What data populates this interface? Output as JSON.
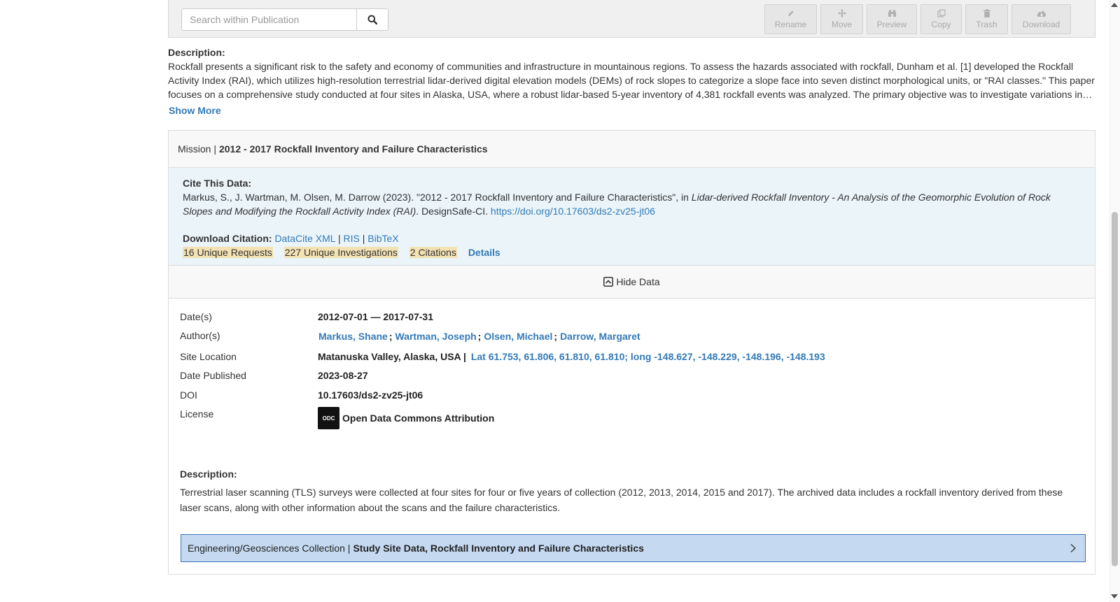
{
  "toolbar": {
    "search_placeholder": "Search within Publication",
    "buttons": [
      {
        "label": "Rename",
        "icon": "pencil-icon"
      },
      {
        "label": "Move",
        "icon": "move-icon"
      },
      {
        "label": "Preview",
        "icon": "binoculars-icon"
      },
      {
        "label": "Copy",
        "icon": "copy-icon"
      },
      {
        "label": "Trash",
        "icon": "trash-icon"
      },
      {
        "label": "Download",
        "icon": "cloud-download-icon"
      }
    ]
  },
  "publication": {
    "description_label": "Description:",
    "description": "Rockfall presents a significant risk to the safety and economy of communities and infrastructure in mountainous regions. To assess the hazards associated with rockfall, Dunham et al. [1] developed the Rockfall Activity Index (RAI), which utilizes high-resolution terrestrial lidar-derived digital elevation models (DEMs) of rock slopes to categorize a slope face into seven distinct morphological units, or \"RAI classes.\" This paper focuses on a comprehensive study conducted at four sites in Alaska, USA, where a robust lidar-based 5-year inventory of 4,381 rockfall events was analyzed. The primary objective was to investigate variations in…",
    "show_more": "Show More"
  },
  "mission": {
    "prefix": "Mission |",
    "title": "2012 - 2017 Rockfall Inventory and Failure Characteristics",
    "cite_label": "Cite This Data:",
    "citation_authors": "Markus, S., J. Wartman, M. Olsen, M. Darrow (2023). \"2012 - 2017 Rockfall Inventory and Failure Characteristics\", in ",
    "citation_project": "Lidar-derived Rockfall Inventory - An Analysis of the Geomorphic Evolution of Rock Slopes and Modifying the Rockfall Activity Index (RAI)",
    "citation_publisher": ". DesignSafe-CI. ",
    "citation_doi_url": "https://doi.org/10.17603/ds2-zv25-jt06",
    "download_label": "Download Citation:",
    "download_links": [
      "DataCite XML",
      "RIS",
      "BibTeX"
    ],
    "metrics": {
      "requests": "16 Unique Requests",
      "investigations": "227 Unique Investigations",
      "citations": "2 Citations",
      "details": "Details"
    },
    "hide_data": "Hide Data",
    "fields": {
      "dates_label": "Date(s)",
      "dates": "2012-07-01 — 2017-07-31",
      "authors_label": "Author(s)",
      "authors": [
        "Markus, Shane",
        "Wartman, Joseph",
        "Olsen, Michael",
        "Darrow, Margaret"
      ],
      "site_label": "Site Location",
      "site": "Matanuska Valley, Alaska, USA |",
      "site_coords": "Lat 61.753, 61.806, 61.810, 61.810; long -148.627, -148.229, -148.196, -148.193",
      "published_label": "Date Published",
      "published": "2023-08-27",
      "doi_label": "DOI",
      "doi": "10.17603/ds2-zv25-jt06",
      "license_label": "License",
      "license": "Open Data Commons Attribution",
      "license_icon_text": "ODC"
    },
    "description_label": "Description:",
    "description": "Terrestrial laser scanning (TLS) surveys were collected at four sites for four or five years of collection (2012, 2013, 2014, 2015 and 2017). The archived data includes a rockfall inventory derived from these laser scans, along with other information about the scans and the failure characteristics.",
    "collection_prefix": "Engineering/Geosciences Collection |",
    "collection_title": "Study Site Data, Rockfall Inventory and Failure Characteristics"
  },
  "colors": {
    "link": "#337ab7",
    "cite_bg": "#eaf4f9",
    "badge_bg": "#f3e2b3",
    "collection_bg": "#c5d9f1",
    "collection_border": "#3b73b9"
  }
}
